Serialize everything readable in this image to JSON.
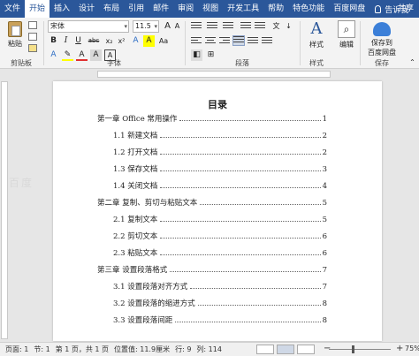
{
  "menu": {
    "tabs": [
      "文件",
      "开始",
      "插入",
      "设计",
      "布局",
      "引用",
      "邮件",
      "审阅",
      "视图",
      "开发工具",
      "帮助",
      "特色功能",
      "百度网盘"
    ],
    "active": "开始",
    "tell_me": "告诉我",
    "share": "共享"
  },
  "ribbon": {
    "clipboard": {
      "paste": "粘贴",
      "label": "剪贴板"
    },
    "font": {
      "name": "宋体",
      "size": "11.5",
      "label": "字体",
      "buttons": [
        "B",
        "I",
        "U",
        "abc",
        "x₂",
        "x²",
        "A",
        "A",
        "Aa",
        "A"
      ]
    },
    "paragraph": {
      "label": "段落"
    },
    "styles": {
      "button": "样式",
      "label": "样式"
    },
    "editing": {
      "button": "编辑"
    },
    "save": {
      "button": "保存到\n百度网盘",
      "line1": "保存到",
      "line2": "百度网盘",
      "label": "保存"
    }
  },
  "document": {
    "title": "目录",
    "toc": [
      {
        "text": "第一章  Office 常用操作",
        "page": "1",
        "level": 1
      },
      {
        "text": "1.1 新建文档",
        "page": "2",
        "level": 2
      },
      {
        "text": "1.2 打开文档",
        "page": "2",
        "level": 2
      },
      {
        "text": "1.3 保存文档",
        "page": "3",
        "level": 2
      },
      {
        "text": "1.4 关闭文档",
        "page": "4",
        "level": 2
      },
      {
        "text": "第二章  复制、剪切与粘贴文本",
        "page": "5",
        "level": 1
      },
      {
        "text": "2.1 复制文本",
        "page": "5",
        "level": 2
      },
      {
        "text": "2.2 剪切文本",
        "page": "6",
        "level": 2
      },
      {
        "text": "2.3 粘贴文本",
        "page": "6",
        "level": 2
      },
      {
        "text": "第三章  设置段落格式",
        "page": "7",
        "level": 1
      },
      {
        "text": "3.1 设置段落对齐方式",
        "page": "7",
        "level": 2
      },
      {
        "text": "3.2 设置段落的缩进方式",
        "page": "8",
        "level": 2
      },
      {
        "text": "3.3 设置段落间距",
        "page": "8",
        "level": 2
      }
    ],
    "watermark": "百度"
  },
  "status": {
    "page_label": "页面: 1",
    "section": "节: 1",
    "pages": "第 1 页，共 1 页",
    "position": "位置值: 11.9厘米",
    "row": "行: 9",
    "col": "列: 114",
    "zoom": "75%"
  }
}
